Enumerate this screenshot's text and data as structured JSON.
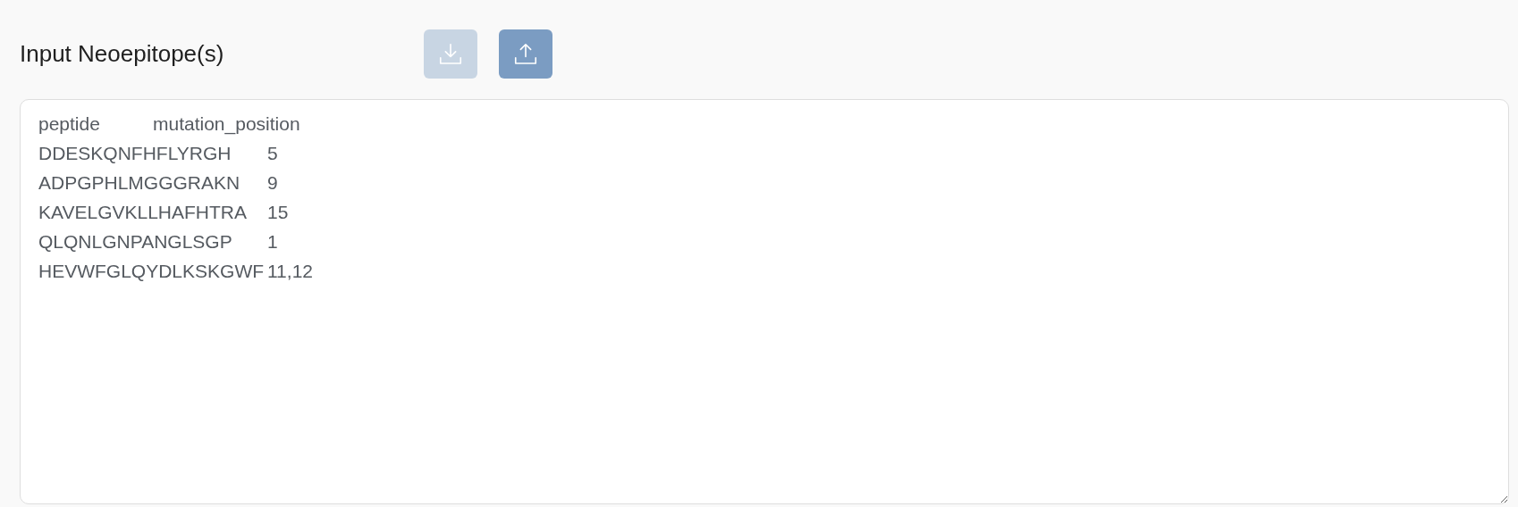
{
  "header": {
    "title": "Input Neoepitope(s)"
  },
  "buttons": [
    {
      "kind": "download",
      "disabled": true
    },
    {
      "kind": "upload",
      "disabled": false
    }
  ],
  "input": {
    "value": "peptide\tmutation_position\nDDESKQNFHFLYRGH\t5\nADPGPHLMGGGRAKN\t9\nKAVELGVKLLHAFHTRA\t15\nQLQNLGNPANGLSGP\t1\nHEVWFGLQYDLKSKGWF\t11,12"
  }
}
